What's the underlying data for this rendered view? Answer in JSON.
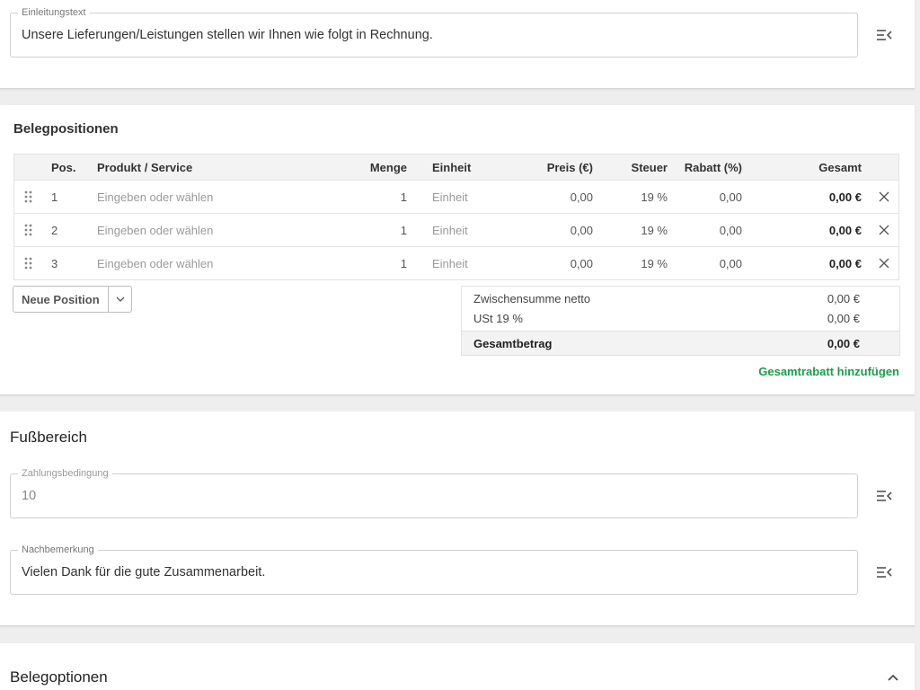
{
  "intro": {
    "label": "Einleitungstext",
    "value": "Unsere Lieferungen/Leistungen stellen wir Ihnen wie folgt in Rechnung.",
    "tool_icon": "text-template-icon"
  },
  "positions": {
    "title": "Belegpositionen",
    "columns": {
      "pos": "Pos.",
      "product": "Produkt / Service",
      "qty": "Menge",
      "unit": "Einheit",
      "price": "Preis (€)",
      "tax": "Steuer",
      "discount": "Rabatt (%)",
      "total": "Gesamt"
    },
    "rows": [
      {
        "pos": "1",
        "product": "Eingeben oder wählen",
        "qty": "1",
        "unit": "Einheit",
        "price": "0,00",
        "tax": "19 %",
        "discount": "0,00",
        "total": "0,00 €"
      },
      {
        "pos": "2",
        "product": "Eingeben oder wählen",
        "qty": "1",
        "unit": "Einheit",
        "price": "0,00",
        "tax": "19 %",
        "discount": "0,00",
        "total": "0,00 €"
      },
      {
        "pos": "3",
        "product": "Eingeben oder wählen",
        "qty": "1",
        "unit": "Einheit",
        "price": "0,00",
        "tax": "19 %",
        "discount": "0,00",
        "total": "0,00 €"
      }
    ],
    "add_button": "Neue Position",
    "totals": {
      "subtotal_label": "Zwischensumme netto",
      "subtotal_value": "0,00 €",
      "vat_label": "USt 19 %",
      "vat_value": "0,00 €",
      "grand_label": "Gesamtbetrag",
      "grand_value": "0,00 €"
    },
    "discount_link": "Gesamtrabatt hinzufügen"
  },
  "footer": {
    "title": "Fußbereich",
    "payment": {
      "label": "Zahlungsbedingung",
      "value": "10"
    },
    "note": {
      "label": "Nachbemerkung",
      "value": "Vielen Dank für die gute Zusammenarbeit."
    }
  },
  "options": {
    "title": "Belegoptionen"
  },
  "colors": {
    "accent_green": "#1a9f49",
    "header_bg": "#f3f3f3",
    "page_bg": "#eeeeee"
  }
}
